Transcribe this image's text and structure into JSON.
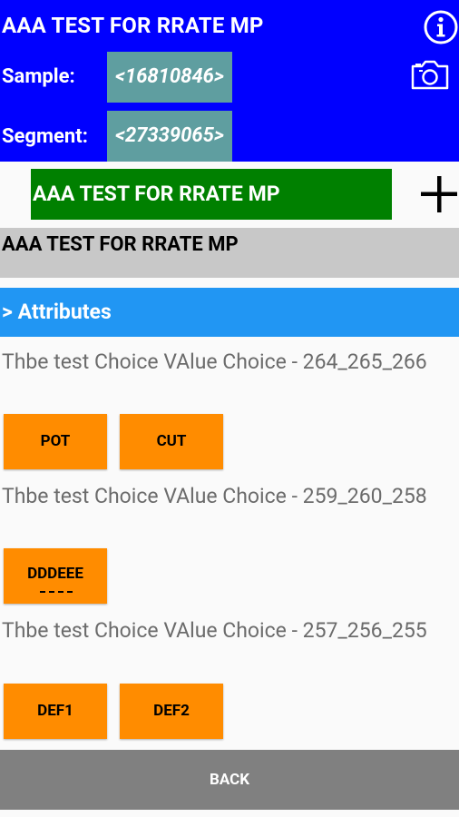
{
  "header": {
    "title": "AAA TEST FOR RRATE MP",
    "sample_label": "Sample:",
    "sample_value": "<16810846>",
    "segment_label": "Segment:",
    "segment_value": "<27339065>",
    "info_icon": "info-circle-icon",
    "camera_icon": "camera-icon",
    "background_color": "#0000ff"
  },
  "selector": {
    "selected": "AAA TEST FOR RRATE MP",
    "add_icon": "plus-icon"
  },
  "item_name": "AAA TEST FOR RRATE MP",
  "attributes": {
    "header_label": "> Attributes",
    "questions": [
      {
        "text": "Thbe test Choice VAlue Choice - 264_265_266",
        "choices": [
          "POT",
          "CUT"
        ]
      },
      {
        "text": "Thbe test Choice VAlue Choice - 259_260_258",
        "choices": [
          "DDDEEE"
        ]
      },
      {
        "text": "Thbe test Choice VAlue Choice - 257_256_255",
        "choices": [
          "DEF1",
          "DEF2"
        ]
      }
    ]
  },
  "footer": {
    "back_label": "BACK"
  },
  "colors": {
    "accent_blue": "#2196f3",
    "green": "#008000",
    "orange": "#ff8c00",
    "teal": "#5f9ea0",
    "gray_button": "#808080"
  }
}
